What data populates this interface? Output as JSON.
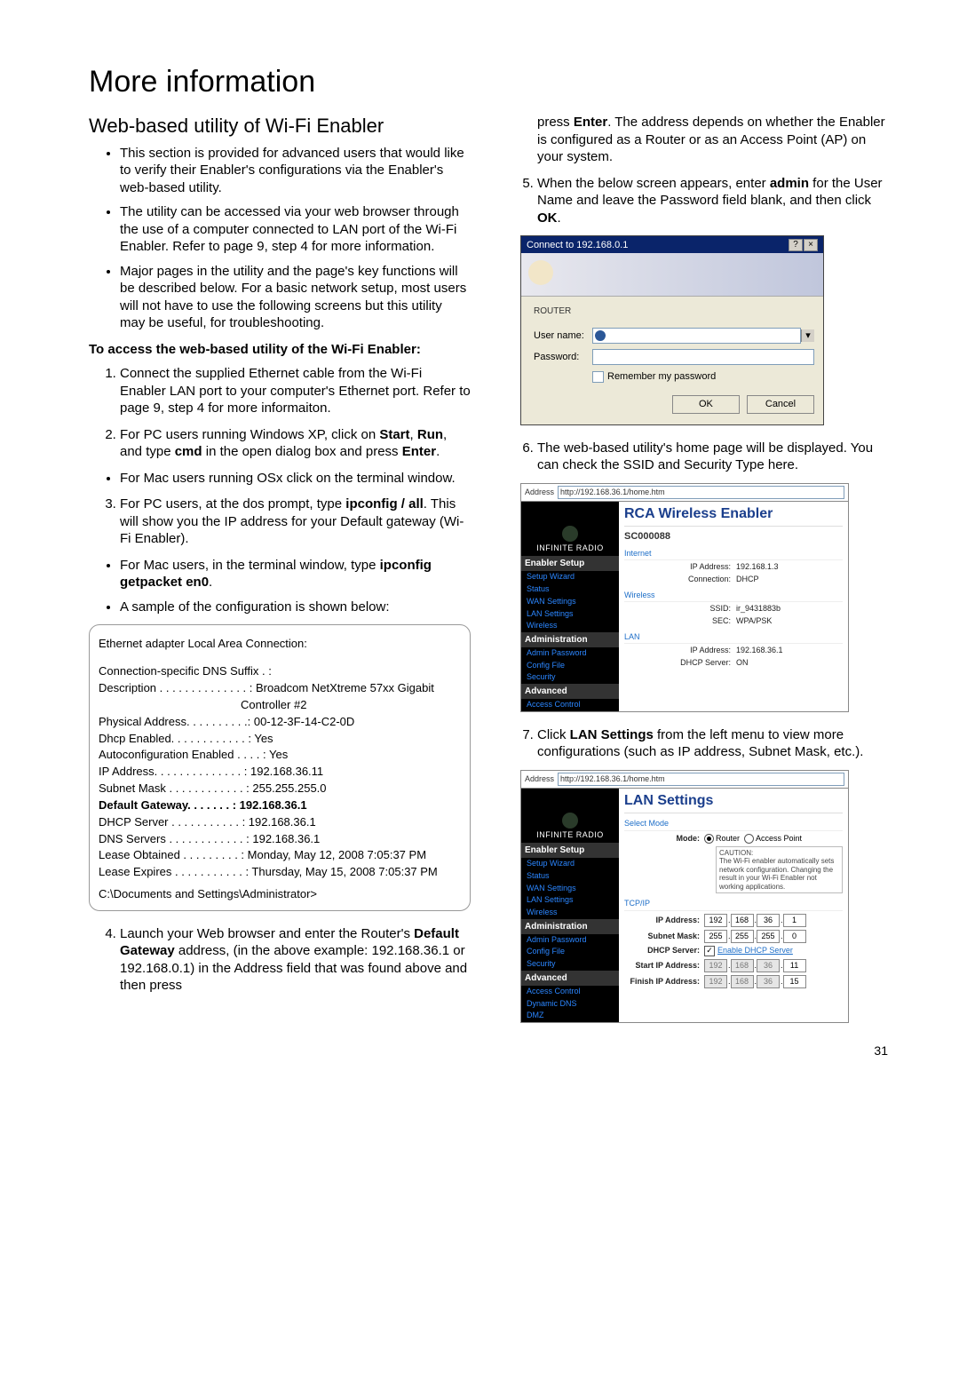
{
  "page_number": "31",
  "h1": "More information",
  "h2": "Web-based utility of Wi-Fi Enabler",
  "intro_bullets": [
    "This section is provided for advanced users that would like to verify their Enabler's configurations via the Enabler's web-based utility.",
    "The utility can be accessed via your web browser through the use of a computer connected to LAN port of the Wi-Fi Enabler. Refer to page 9, step 4 for more information.",
    "Major pages in the utility and the page's key functions will be described below.  For a basic network setup, most users will not have to use the following screens but this utility may be useful, for troubleshooting."
  ],
  "access_heading": "To access the web-based utility of the Wi-Fi Enabler:",
  "step1": "Connect the supplied Ethernet cable from the Wi-Fi Enabler LAN port to your computer's Ethernet port. Refer to page 9, step 4 for more informaiton.",
  "step2_pre": "For PC users running Windows XP, click on ",
  "step2_b1": "Start",
  "step2_mid1": ", ",
  "step2_b2": "Run",
  "step2_mid2": ", and type ",
  "step2_b3": "cmd",
  "step2_mid3": " in the open dialog box and press ",
  "step2_b4": "Enter",
  "step2_end": ".",
  "step2_sub": "For Mac users running OSx click on the terminal window.",
  "step3_pre": "For PC users, at the dos prompt, type ",
  "step3_b1": "ipconfig / all",
  "step3_end": ".  This will show you the IP address for your Default gateway (Wi-Fi Enabler).",
  "step3_sub1_pre": "For Mac users, in the terminal window, type ",
  "step3_sub1_b": "ipconfig getpacket en0",
  "step3_sub1_end": ".",
  "step3_sub2": "A sample of the configuration is shown below:",
  "sample": {
    "l1": "Ethernet adapter Local Area Connection:",
    "l2": "Connection-specific DNS Suffix   . :",
    "l3": "Description . . . . . . . . . . . . . . : Broadcom NetXtreme 57xx Gigabit",
    "l3b": "Controller #2",
    "l4": "Physical Address. . . . . . . . . .: 00-12-3F-14-C2-0D",
    "l5": "Dhcp Enabled. . . . . . . . . . . . : Yes",
    "l6": "Autoconfiguration Enabled . . . . : Yes",
    "l7": "IP Address. . . . . . . . . . . . . . : 192.168.36.11",
    "l8": "Subnet Mask . . . . . . . . . . . . : 255.255.255.0",
    "l9": "Default Gateway. . . . . . . : 192.168.36.1",
    "l10": "DHCP Server . . . . . . . . . . . : 192.168.36.1",
    "l11": "DNS Servers . . . . . . . . . . . . : 192.168.36.1",
    "l12": "Lease Obtained . . . . . . . . . : Monday, May 12, 2008 7:05:37 PM",
    "l13": "Lease Expires . . . . . . . . . . . : Thursday, May 15, 2008 7:05:37 PM",
    "l14": "C:\\Documents and Settings\\Administrator>"
  },
  "step4_pre": "Launch your Web browser and enter the Router's ",
  "step4_b1": "Default Gateway",
  "step4_mid1": " address, (in the above example: 192.168.36.1 or 192.168.0.1) in the Address field that was found above and then press ",
  "step4_b2": "Enter",
  "step4_end": ".  The address depends on whether the Enabler is configured as a Router or as an Access Point (AP) on your system.",
  "step5_pre": "When the below screen appears, enter ",
  "step5_b1": "admin",
  "step5_mid1": " for the User Name and leave the Password field blank, and then click ",
  "step5_b2": "OK",
  "step5_end": ".",
  "auth": {
    "title": "Connect to 192.168.0.1",
    "router": "ROUTER",
    "user_label": "User name:",
    "user_value": "",
    "pass_label": "Password:",
    "remember": "Remember my password",
    "ok": "OK",
    "cancel": "Cancel"
  },
  "step6": "The web-based utility's home page will be displayed. You can check the SSID and Security Type here.",
  "shot2": {
    "addr_label": "Address",
    "url": "http://192.168.36.1/home.htm",
    "logo": "INFINITE RADIO",
    "side_hdr1": "Enabler Setup",
    "side_items1": [
      "Setup Wizard",
      "Status",
      "WAN Settings",
      "LAN Settings",
      "Wireless"
    ],
    "side_hdr2": "Administration",
    "side_items2": [
      "Admin Password",
      "Config File",
      "Security"
    ],
    "side_hdr3": "Advanced",
    "side_items3": [
      "Access Control"
    ],
    "title": "RCA Wireless Enabler",
    "model": "SC000088",
    "sec_internet": "Internet",
    "ip_lbl": "IP Address:",
    "ip_val": "192.168.1.3",
    "conn_lbl": "Connection:",
    "conn_val": "DHCP",
    "sec_wireless": "Wireless",
    "ssid_lbl": "SSID:",
    "ssid_val": "ir_9431883b",
    "sec_lbl": "SEC:",
    "sec_val": "WPA/PSK",
    "sec_lan": "LAN",
    "lan_ip_lbl": "IP Address:",
    "lan_ip_val": "192.168.36.1",
    "dhcp_lbl": "DHCP Server:",
    "dhcp_val": "ON"
  },
  "step7_pre": "Click ",
  "step7_b1": "LAN Settings",
  "step7_end": " from the left menu to view more configurations (such as IP address, Subnet Mask, etc.).",
  "shot3": {
    "addr_label": "Address",
    "url": "http://192.168.36.1/home.htm",
    "logo": "INFINITE RADIO",
    "side_hdr1": "Enabler Setup",
    "side_items1": [
      "Setup Wizard",
      "Status",
      "WAN Settings",
      "LAN Settings",
      "Wireless"
    ],
    "side_hdr2": "Administration",
    "side_items2": [
      "Admin Password",
      "Config File",
      "Security"
    ],
    "side_hdr3": "Advanced",
    "side_items3": [
      "Access Control",
      "Dynamic DNS",
      "DMZ"
    ],
    "title": "LAN Settings",
    "select_mode": "Select Mode",
    "mode_lbl": "Mode:",
    "mode_router": "Router",
    "mode_ap": "Access Point",
    "caution_hdr": "CAUTION:",
    "caution_txt": "The Wi-Fi enabler automatically sets network configuration. Changing the result in your Wi-Fi Enabler not working applications.",
    "tcpip": "TCP/IP",
    "ip_lbl": "IP Address:",
    "ip_oct": [
      "192",
      "168",
      "36",
      "1"
    ],
    "sm_lbl": "Subnet Mask:",
    "sm_oct": [
      "255",
      "255",
      "255",
      "0"
    ],
    "dhcp_lbl": "DHCP Server:",
    "dhcp_link": "Enable DHCP Server",
    "start_lbl": "Start IP Address:",
    "start_oct": [
      "192",
      "168",
      "36",
      "11"
    ],
    "finish_lbl": "Finish IP Address:",
    "finish_oct": [
      "192",
      "168",
      "36",
      "15"
    ]
  }
}
